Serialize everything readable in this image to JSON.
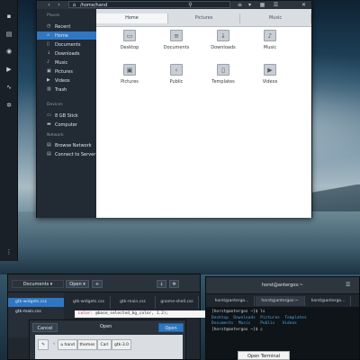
{
  "file_manager": {
    "path": "/home/hand",
    "tabs": [
      "Home",
      "Pictures",
      "Music"
    ],
    "sidebar": {
      "places_header": "Places",
      "places": [
        "Recent",
        "Home",
        "Documents",
        "Downloads",
        "Music",
        "Pictures",
        "Videos",
        "Trash"
      ],
      "devices_header": "Devices",
      "devices": [
        "8 GB Stick",
        "Computer"
      ],
      "network_header": "Network",
      "network": [
        "Browse Network",
        "Connect to Server"
      ]
    },
    "folders": [
      "Desktop",
      "Documents",
      "Downloads",
      "Music",
      "Pictures",
      "Public",
      "Templates",
      "Videos"
    ]
  },
  "editor": {
    "open_label": "Open",
    "documents_label": "Documents",
    "files": [
      "gtk-widgets.css",
      "gtk-main.css"
    ],
    "tabs": [
      "gtk-widgets.css",
      "gtk-main.css",
      "gnome-shell.css"
    ],
    "code_keyword": "color:",
    "code_rest": "@base_selected_bg_color, 1.2);"
  },
  "open_dialog": {
    "cancel_label": "Cancel",
    "title": "Open",
    "open_label": "Open",
    "crumbs": [
      "hand",
      "themes",
      "Carl",
      "gtk-3.0"
    ]
  },
  "terminal": {
    "title": "horst@antergos:~",
    "tabs": [
      "horst@antergo...",
      "horst@antergos:~",
      "horst@antergo..."
    ],
    "prompt_line": "[horst@antergos ~]$ ls",
    "ls_row1": [
      "Desktop",
      "Downloads",
      "Pictures",
      "Templates"
    ],
    "ls_row2": [
      "Documents",
      "Music",
      "Public",
      "Videos"
    ],
    "prompt_end": "[horst@antergos ~]$ ▯",
    "popup": "Open Terminal"
  }
}
